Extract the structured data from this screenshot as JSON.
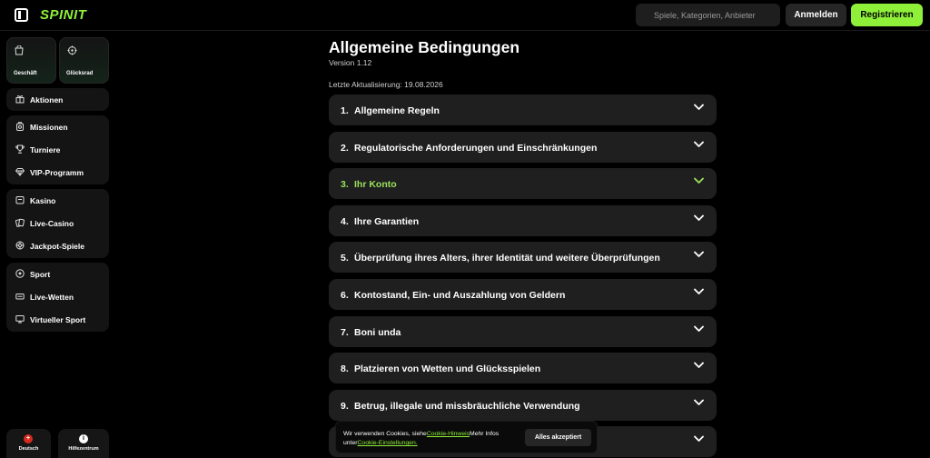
{
  "header": {
    "logo": "SPINIT",
    "search_placeholder": "Spiele, Kategorien, Anbieter",
    "login_label": "Anmelden",
    "register_label": "Registrieren",
    "accent_color": "#8ff03a"
  },
  "sidebar": {
    "tiles": [
      {
        "label": "Geschäft",
        "icon": "shopping-bag-icon"
      },
      {
        "label": "Glücksrad",
        "icon": "wheel-icon"
      }
    ],
    "promotions": {
      "label": "Aktionen",
      "icon": "gift-icon"
    },
    "group_engagement": [
      {
        "label": "Missionen",
        "icon": "mission-icon"
      },
      {
        "label": "Turniere",
        "icon": "trophy-icon"
      },
      {
        "label": "VIP-Programm",
        "icon": "diamond-icon"
      }
    ],
    "group_casino": [
      {
        "label": "Kasino",
        "icon": "slot-machine-icon"
      },
      {
        "label": "Live-Casino",
        "icon": "cards-icon"
      },
      {
        "label": "Jackpot-Spiele",
        "icon": "jackpot-icon"
      }
    ],
    "group_sport": [
      {
        "label": "Sport",
        "icon": "soccer-ball-icon"
      },
      {
        "label": "Live-Wetten",
        "icon": "live-betting-icon"
      },
      {
        "label": "Virtueller Sport",
        "icon": "monitor-icon"
      }
    ],
    "footer": {
      "language_label": "Deutsch",
      "help_label": "Hilfezentrum"
    }
  },
  "main": {
    "title": "Allgemeine Bedingungen",
    "version": "Version 1.12",
    "last_updated": "Letzte Aktualisierung: 19.08.2026",
    "active_index": 2,
    "sections": [
      {
        "num": "1.",
        "title": "Allgemeine Regeln"
      },
      {
        "num": "2.",
        "title": "Regulatorische Anforderungen und Einschränkungen"
      },
      {
        "num": "3.",
        "title": "Ihr Konto"
      },
      {
        "num": "4.",
        "title": "Ihre Garantien"
      },
      {
        "num": "5.",
        "title": "Überprüfung ihres Alters, ihrer Identität und weitere Überprüfungen"
      },
      {
        "num": "6.",
        "title": "Kontostand, Ein- und Auszahlung von Geldern"
      },
      {
        "num": "7.",
        "title": "Boni unda"
      },
      {
        "num": "8.",
        "title": "Platzieren von Wetten und Glücksspielen"
      },
      {
        "num": "9.",
        "title": "Betrug, illegale und missbräuchliche Verwendung"
      },
      {
        "num": "",
        "title": ""
      }
    ]
  },
  "cookie": {
    "text_1": "Wir verwenden Cookies, siehe",
    "link_1": "Cookie-Hinweis",
    "text_2": "Mehr Infos unter",
    "link_2": "Cookie-Einstellungen.",
    "accept_label": "Alles akzeptiert"
  }
}
